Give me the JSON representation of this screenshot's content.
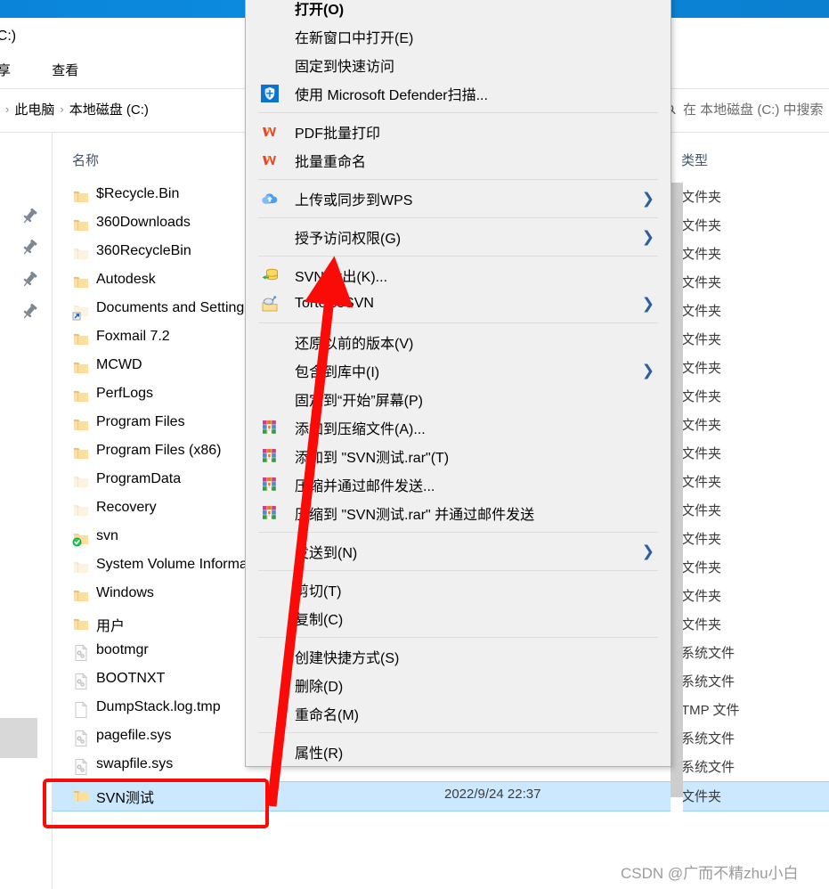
{
  "window": {
    "title": "磁盘 (C:)",
    "ribbon_tabs": [
      "共享",
      "查看"
    ]
  },
  "address_bar": {
    "crumbs": [
      "此电脑",
      "本地磁盘 (C:)"
    ],
    "arrow_glyph": "›"
  },
  "search": {
    "placeholder": "在 本地磁盘 (C:) 中搜索",
    "icon": "search-icon"
  },
  "columns": {
    "name": "名称",
    "type": "类型"
  },
  "files": [
    {
      "name": "$Recycle.Bin",
      "icon": "folder-icon",
      "type": "文件夹",
      "date": "",
      "selected": false
    },
    {
      "name": "360Downloads",
      "icon": "folder-icon",
      "type": "文件夹",
      "date": "",
      "selected": false
    },
    {
      "name": "360RecycleBin",
      "icon": "folder-dim-icon",
      "type": "文件夹",
      "date": "",
      "selected": false
    },
    {
      "name": "Autodesk",
      "icon": "folder-icon",
      "type": "文件夹",
      "date": "",
      "selected": false
    },
    {
      "name": "Documents and Settings",
      "icon": "folder-shortcut-icon",
      "type": "文件夹",
      "date": "",
      "selected": false
    },
    {
      "name": "Foxmail 7.2",
      "icon": "folder-icon",
      "type": "文件夹",
      "date": "",
      "selected": false
    },
    {
      "name": "MCWD",
      "icon": "folder-icon",
      "type": "文件夹",
      "date": "",
      "selected": false
    },
    {
      "name": "PerfLogs",
      "icon": "folder-icon",
      "type": "文件夹",
      "date": "",
      "selected": false
    },
    {
      "name": "Program Files",
      "icon": "folder-icon",
      "type": "文件夹",
      "date": "",
      "selected": false
    },
    {
      "name": "Program Files (x86)",
      "icon": "folder-icon",
      "type": "文件夹",
      "date": "",
      "selected": false
    },
    {
      "name": "ProgramData",
      "icon": "folder-dim-icon",
      "type": "文件夹",
      "date": "",
      "selected": false
    },
    {
      "name": "Recovery",
      "icon": "folder-dim-icon",
      "type": "文件夹",
      "date": "",
      "selected": false
    },
    {
      "name": "svn",
      "icon": "folder-svn-icon",
      "type": "文件夹",
      "date": "",
      "selected": false
    },
    {
      "name": "System Volume Information",
      "icon": "folder-dim-icon",
      "type": "文件夹",
      "date": "",
      "selected": false
    },
    {
      "name": "Windows",
      "icon": "folder-icon",
      "type": "文件夹",
      "date": "",
      "selected": false
    },
    {
      "name": "用户",
      "icon": "folder-icon",
      "type": "文件夹",
      "date": "",
      "selected": false
    },
    {
      "name": "bootmgr",
      "icon": "system-file-icon",
      "type": "系统文件",
      "date": "",
      "selected": false
    },
    {
      "name": "BOOTNXT",
      "icon": "system-file-icon",
      "type": "系统文件",
      "date": "",
      "selected": false
    },
    {
      "name": "DumpStack.log.tmp",
      "icon": "blank-file-icon",
      "type": "TMP 文件",
      "date": "",
      "selected": false
    },
    {
      "name": "pagefile.sys",
      "icon": "system-file-icon",
      "type": "系统文件",
      "date": "",
      "selected": false
    },
    {
      "name": "swapfile.sys",
      "icon": "system-file-icon",
      "type": "系统文件",
      "date": "",
      "selected": false
    },
    {
      "name": "SVN测试",
      "icon": "folder-icon",
      "type": "文件夹",
      "date": "2022/9/24 22:37",
      "selected": true
    }
  ],
  "context_menu": [
    {
      "label": "打开(O)",
      "icon": "",
      "submenu": false,
      "bold": true,
      "sep_after": false
    },
    {
      "label": "在新窗口中打开(E)",
      "icon": "",
      "submenu": false,
      "bold": false,
      "sep_after": false
    },
    {
      "label": "固定到快速访问",
      "icon": "",
      "submenu": false,
      "bold": false,
      "sep_after": false
    },
    {
      "label": "使用 Microsoft Defender扫描...",
      "icon": "defender-shield-icon",
      "submenu": false,
      "bold": false,
      "sep_after": true
    },
    {
      "label": "PDF批量打印",
      "icon": "wps-icon",
      "submenu": false,
      "bold": false,
      "sep_after": false
    },
    {
      "label": "批量重命名",
      "icon": "wps-icon",
      "submenu": false,
      "bold": false,
      "sep_after": true
    },
    {
      "label": "上传或同步到WPS",
      "icon": "wps-cloud-icon",
      "submenu": true,
      "bold": false,
      "sep_after": true
    },
    {
      "label": "授予访问权限(G)",
      "icon": "",
      "submenu": true,
      "bold": false,
      "sep_after": true
    },
    {
      "label": "SVN 检出(K)...",
      "icon": "svn-checkout-icon",
      "submenu": false,
      "bold": false,
      "sep_after": false
    },
    {
      "label": "TortoiseSVN",
      "icon": "tortoisesvn-icon",
      "submenu": true,
      "bold": false,
      "sep_after": true
    },
    {
      "label": "还原以前的版本(V)",
      "icon": "",
      "submenu": false,
      "bold": false,
      "sep_after": false
    },
    {
      "label": "包含到库中(I)",
      "icon": "",
      "submenu": true,
      "bold": false,
      "sep_after": false
    },
    {
      "label": "固定到“开始”屏幕(P)",
      "icon": "",
      "submenu": false,
      "bold": false,
      "sep_after": false
    },
    {
      "label": "添加到压缩文件(A)...",
      "icon": "winrar-icon",
      "submenu": false,
      "bold": false,
      "sep_after": false
    },
    {
      "label": "添加到 \"SVN测试.rar\"(T)",
      "icon": "winrar-icon",
      "submenu": false,
      "bold": false,
      "sep_after": false
    },
    {
      "label": "压缩并通过邮件发送...",
      "icon": "winrar-icon",
      "submenu": false,
      "bold": false,
      "sep_after": false
    },
    {
      "label": "压缩到 \"SVN测试.rar\" 并通过邮件发送",
      "icon": "winrar-icon",
      "submenu": false,
      "bold": false,
      "sep_after": true
    },
    {
      "label": "发送到(N)",
      "icon": "",
      "submenu": true,
      "bold": false,
      "sep_after": true
    },
    {
      "label": "剪切(T)",
      "icon": "",
      "submenu": false,
      "bold": false,
      "sep_after": false
    },
    {
      "label": "复制(C)",
      "icon": "",
      "submenu": false,
      "bold": false,
      "sep_after": true
    },
    {
      "label": "创建快捷方式(S)",
      "icon": "",
      "submenu": false,
      "bold": false,
      "sep_after": false
    },
    {
      "label": "删除(D)",
      "icon": "",
      "submenu": false,
      "bold": false,
      "sep_after": false
    },
    {
      "label": "重命名(M)",
      "icon": "",
      "submenu": false,
      "bold": false,
      "sep_after": true
    },
    {
      "label": "属性(R)",
      "icon": "",
      "submenu": false,
      "bold": false,
      "sep_after": false
    }
  ],
  "annotations": {
    "arrow_color": "#fb0b08",
    "box_color": "#fb0b08"
  },
  "watermark": "CSDN @广而不精zhu小白",
  "colors": {
    "titlebar": "#0c8ce0",
    "selection": "#cce8ff",
    "menu_bg": "#f0f0f0",
    "header_text": "#44546d"
  }
}
